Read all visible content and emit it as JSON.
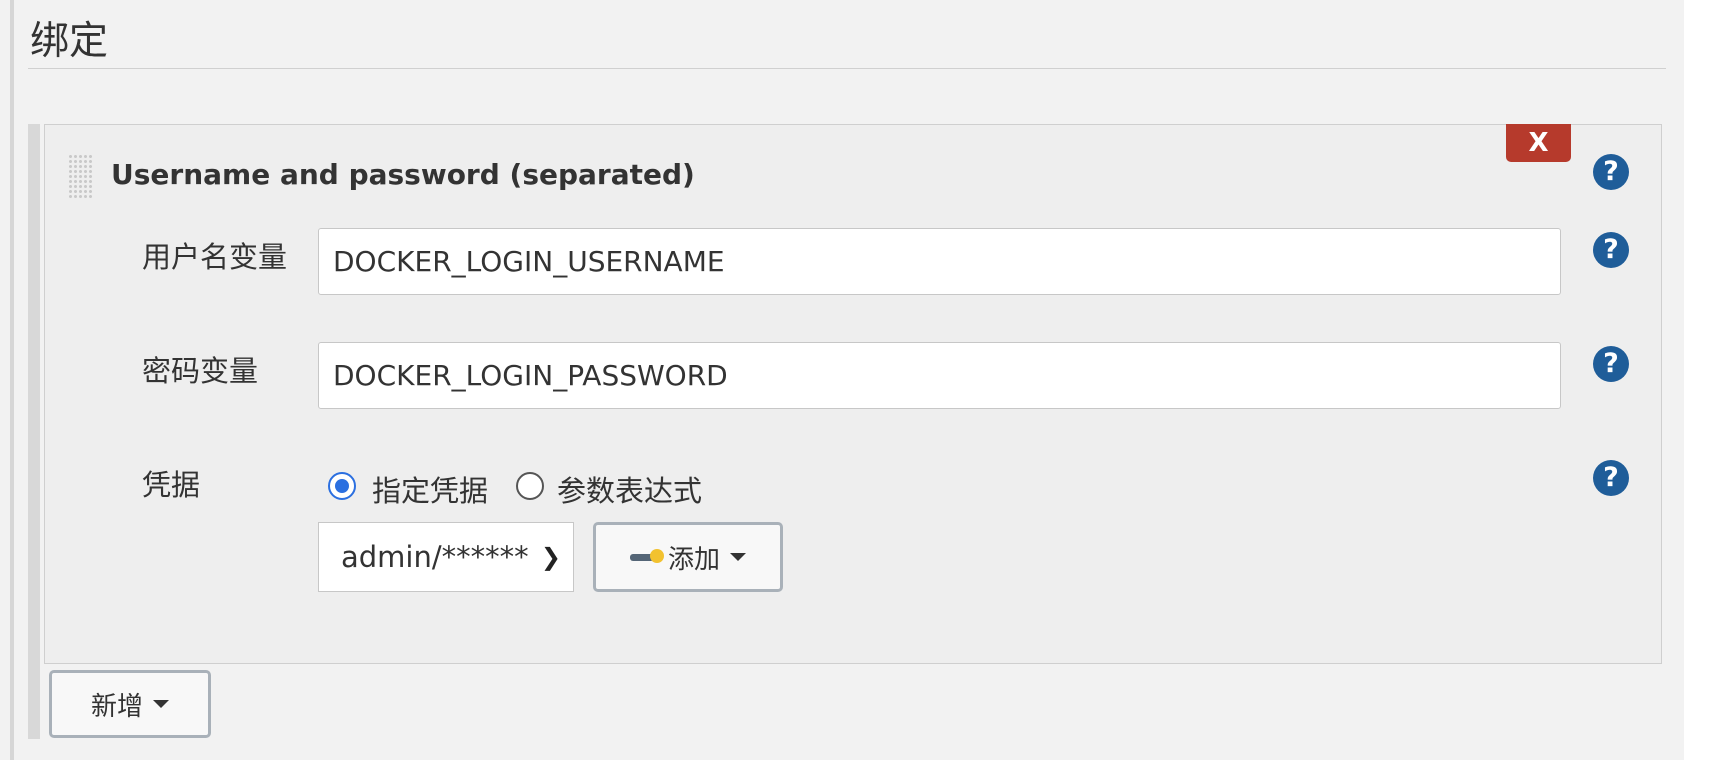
{
  "section": {
    "title": "绑定"
  },
  "binding": {
    "title": "Username and password (separated)",
    "delete_label": "X",
    "help_symbol": "?",
    "username_label": "用户名变量",
    "username_value": "DOCKER_LOGIN_USERNAME",
    "password_label": "密码变量",
    "password_value": "DOCKER_LOGIN_PASSWORD",
    "credentials_label": "凭据",
    "radio_specific": "指定凭据",
    "radio_expression": "参数表达式",
    "radio_selected": "指定凭据",
    "credential_selected": "admin/******",
    "add_label": "添加"
  },
  "footer": {
    "new_label": "新增"
  },
  "colors": {
    "accent": "#2b6fe0",
    "delete": "#b63a2c",
    "help": "#1f5d99"
  },
  "icons": {
    "key": "key-icon",
    "caret": "caret-down-icon",
    "help": "help-icon"
  }
}
